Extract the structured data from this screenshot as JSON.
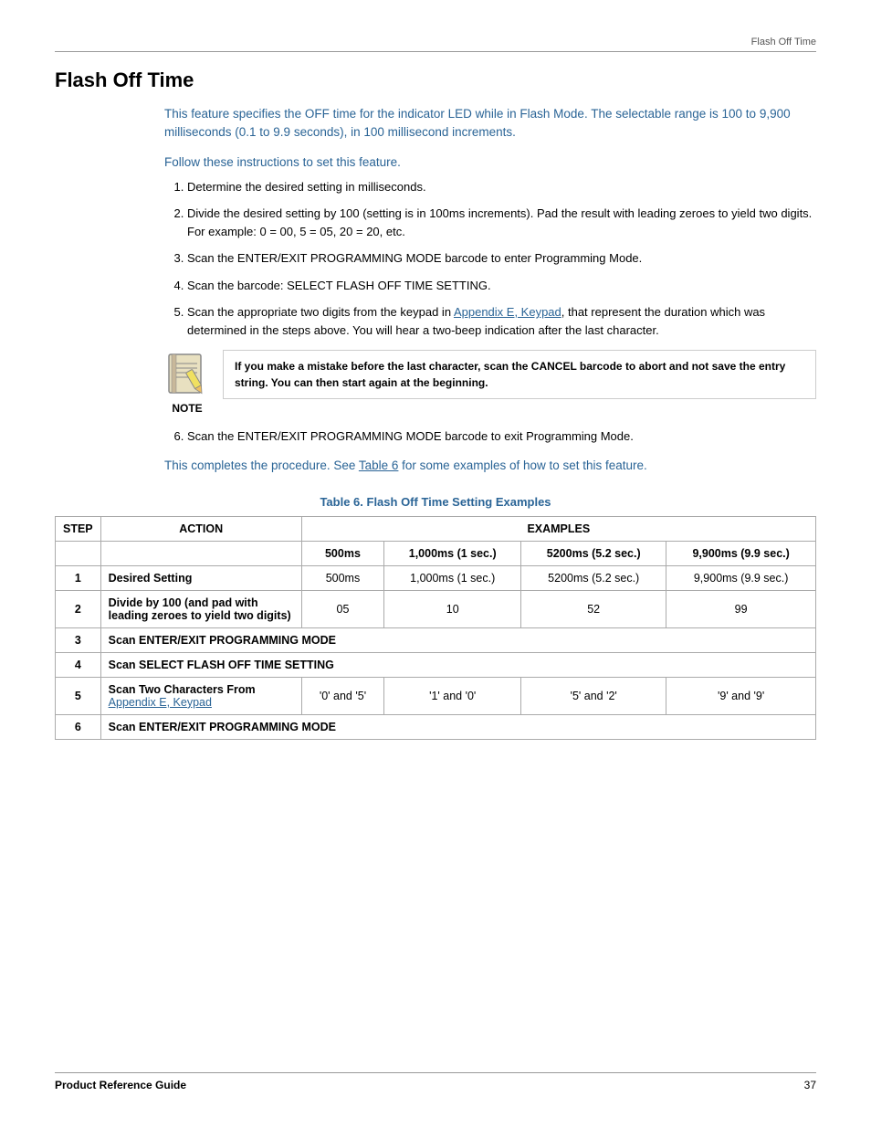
{
  "header": {
    "text": "Flash Off Time"
  },
  "section": {
    "title": "Flash Off Time",
    "intro": "This feature specifies the OFF time for the indicator LED while in Flash Mode. The selectable range is 100 to 9,900 milliseconds (0.1 to 9.9 seconds), in 100 millisecond increments.",
    "follow": "Follow these instructions to set this feature.",
    "steps": [
      "Determine the desired setting in milliseconds.",
      "Divide the desired setting by 100 (setting is in 100ms increments). Pad the result with leading zeroes to yield two digits. For example: 0 = 00, 5 = 05, 20 = 20, etc.",
      "Scan the ENTER/EXIT PROGRAMMING MODE barcode to enter Programming Mode.",
      "Scan the barcode: SELECT FLASH OFF TIME SETTING.",
      "Scan the appropriate two digits from the keypad in Appendix E, Keypad, that represent the duration which was determined in the steps above. You will hear a two-beep indication after the last character.",
      "Scan the ENTER/EXIT PROGRAMMING MODE barcode to exit Programming Mode."
    ],
    "step5_link_text": "Appendix E, Keypad",
    "note": {
      "bold_text": "If you make a mistake before the last character, scan the CANCEL barcode to abort and not save the entry string. You can then start again at the beginning.",
      "label": "NOTE"
    },
    "completes": "This completes the procedure. See Table 6 for some examples of how to set this feature.",
    "completes_link": "Table 6"
  },
  "table": {
    "title": "Table 6. Flash Off Time Setting Examples",
    "headers": {
      "step": "STEP",
      "action": "ACTION",
      "examples": "EXAMPLES"
    },
    "example_cols": [
      "500ms",
      "1,000ms (1 sec.)",
      "5200ms (5.2 sec.)",
      "9,900ms (9.9 sec.)"
    ],
    "rows": [
      {
        "step": "1",
        "action": "Desired Setting",
        "action_bold": true,
        "values": [
          "500ms",
          "1,000ms (1 sec.)",
          "5200ms (5.2 sec.)",
          "9,900ms (9.9 sec.)"
        ]
      },
      {
        "step": "2",
        "action": "Divide by 100 (and pad with leading zeroes to yield two digits)",
        "action_bold": true,
        "values": [
          "05",
          "10",
          "52",
          "99"
        ]
      },
      {
        "step": "3",
        "action": "Scan ENTER/EXIT PROGRAMMING MODE",
        "action_bold": true,
        "span": true
      },
      {
        "step": "4",
        "action": "Scan SELECT FLASH OFF TIME SETTING",
        "action_bold": true,
        "span": true
      },
      {
        "step": "5",
        "action": "Scan Two Characters From",
        "action_line2": "Appendix E, Keypad",
        "action_line2_link": true,
        "action_bold": true,
        "values": [
          "'0' and '5'",
          "'1' and '0'",
          "'5' and '2'",
          "'9' and '9'"
        ]
      },
      {
        "step": "6",
        "action": "Scan ENTER/EXIT PROGRAMMING MODE",
        "action_bold": true,
        "span": true
      }
    ]
  },
  "footer": {
    "left": "Product Reference Guide",
    "right": "37"
  }
}
